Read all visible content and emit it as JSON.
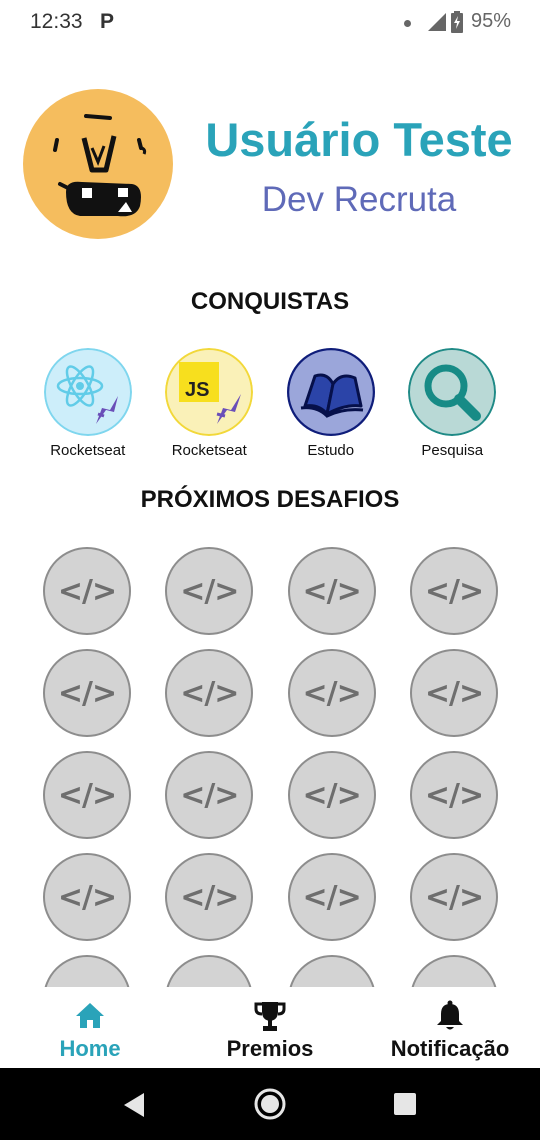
{
  "status_bar": {
    "time": "12:33",
    "notification_icon": "P",
    "battery_percent": "95%"
  },
  "profile": {
    "name": "Usuário Teste",
    "role": "Dev Recruta",
    "avatar_icon": "monster-avatar-icon"
  },
  "achievements": {
    "title": "CONQUISTAS",
    "items": [
      {
        "label": "Rocketseat",
        "icon": "react-rocket-icon"
      },
      {
        "label": "Rocketseat",
        "icon": "js-rocket-icon"
      },
      {
        "label": "Estudo",
        "icon": "book-icon"
      },
      {
        "label": "Pesquisa",
        "icon": "magnifier-icon"
      }
    ]
  },
  "challenges": {
    "title": "PRÓXIMOS DESAFIOS",
    "code_symbol": "</>"
  },
  "bottom_nav": {
    "items": [
      {
        "label": "Home",
        "icon": "home-icon",
        "active": true
      },
      {
        "label": "Premios",
        "icon": "trophy-icon",
        "active": false
      },
      {
        "label": "Notificação",
        "icon": "bell-icon",
        "active": false
      }
    ]
  },
  "colors": {
    "accent": "#2aa3b9",
    "role": "#5f6ab8",
    "challenge_bg": "#d3d3d3"
  }
}
